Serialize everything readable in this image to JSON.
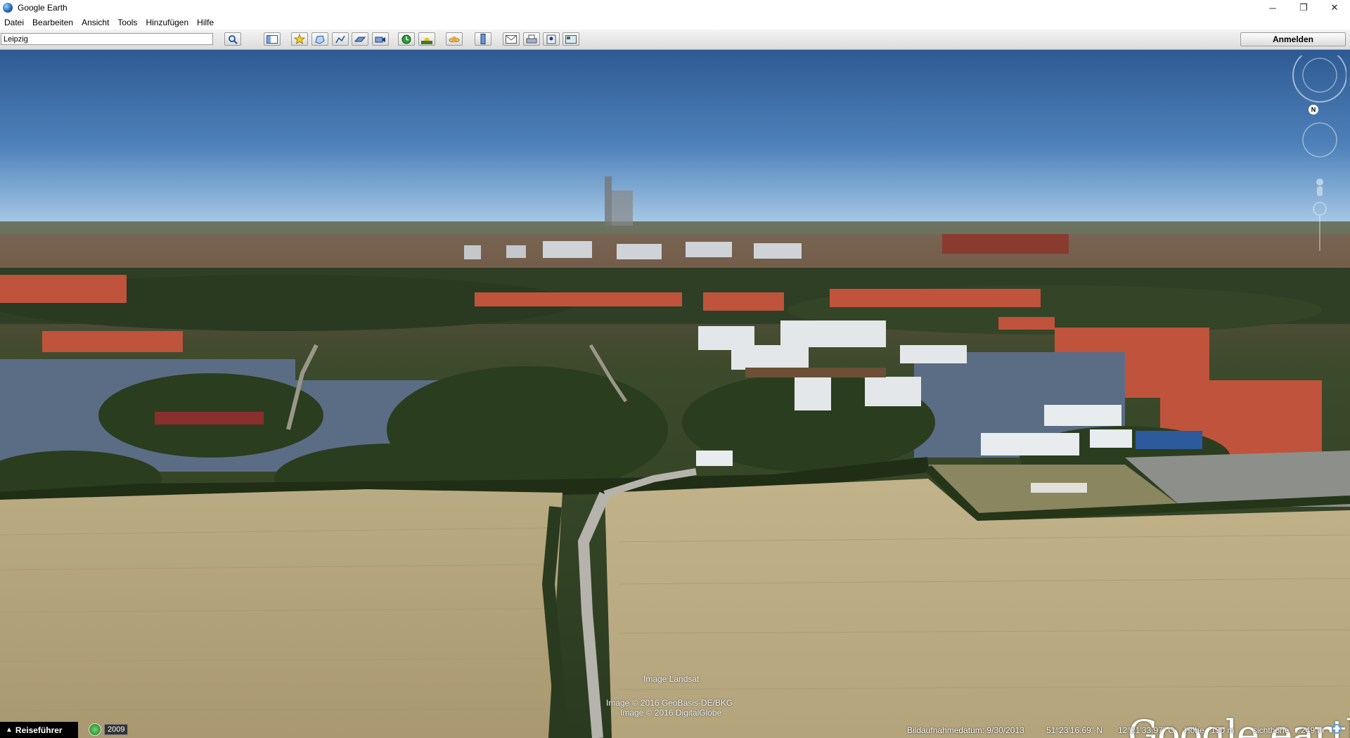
{
  "window": {
    "title": "Google Earth"
  },
  "menu": [
    "Datei",
    "Bearbeiten",
    "Ansicht",
    "Tools",
    "Hinzufügen",
    "Hilfe"
  ],
  "search": {
    "value": "Leipzig"
  },
  "toolbar": {
    "signin_label": "Anmelden",
    "icons": [
      "search-icon",
      "sidebar-toggle-icon",
      "placemark-icon",
      "polygon-icon",
      "path-icon",
      "image-overlay-icon",
      "record-tour-icon",
      "historical-imagery-icon",
      "sunlight-icon",
      "planets-icon",
      "ruler-icon",
      "email-icon",
      "print-icon",
      "save-image-icon",
      "view-in-maps-icon"
    ]
  },
  "navigation": {
    "north_label": "N"
  },
  "viewport": {
    "imagery_credits": [
      "Image Landsat",
      "Image © 2016 GeoBasis-DE/BKG",
      "Image © 2016 DigitalGlobe"
    ],
    "logo": "Google earth"
  },
  "status": {
    "guide_label": "Reiseführer",
    "history_year": "2009",
    "imagery_date": "Bildaufnahmedatum: 9/30/2013",
    "latitude": "51°23'16.69\" N",
    "longitude": "12°21'33.97\" O",
    "elevation_label": "Höhe",
    "elevation_value": "130 m",
    "eye_alt_label": "sichthöhe",
    "eye_alt_value": "249 m"
  },
  "colors": {
    "sky_top": "#2e5a93",
    "sky_horizon": "#a9cbe6",
    "field": "#b8a77c",
    "trees": "#2e3f22",
    "roofs": "#c0533c"
  }
}
